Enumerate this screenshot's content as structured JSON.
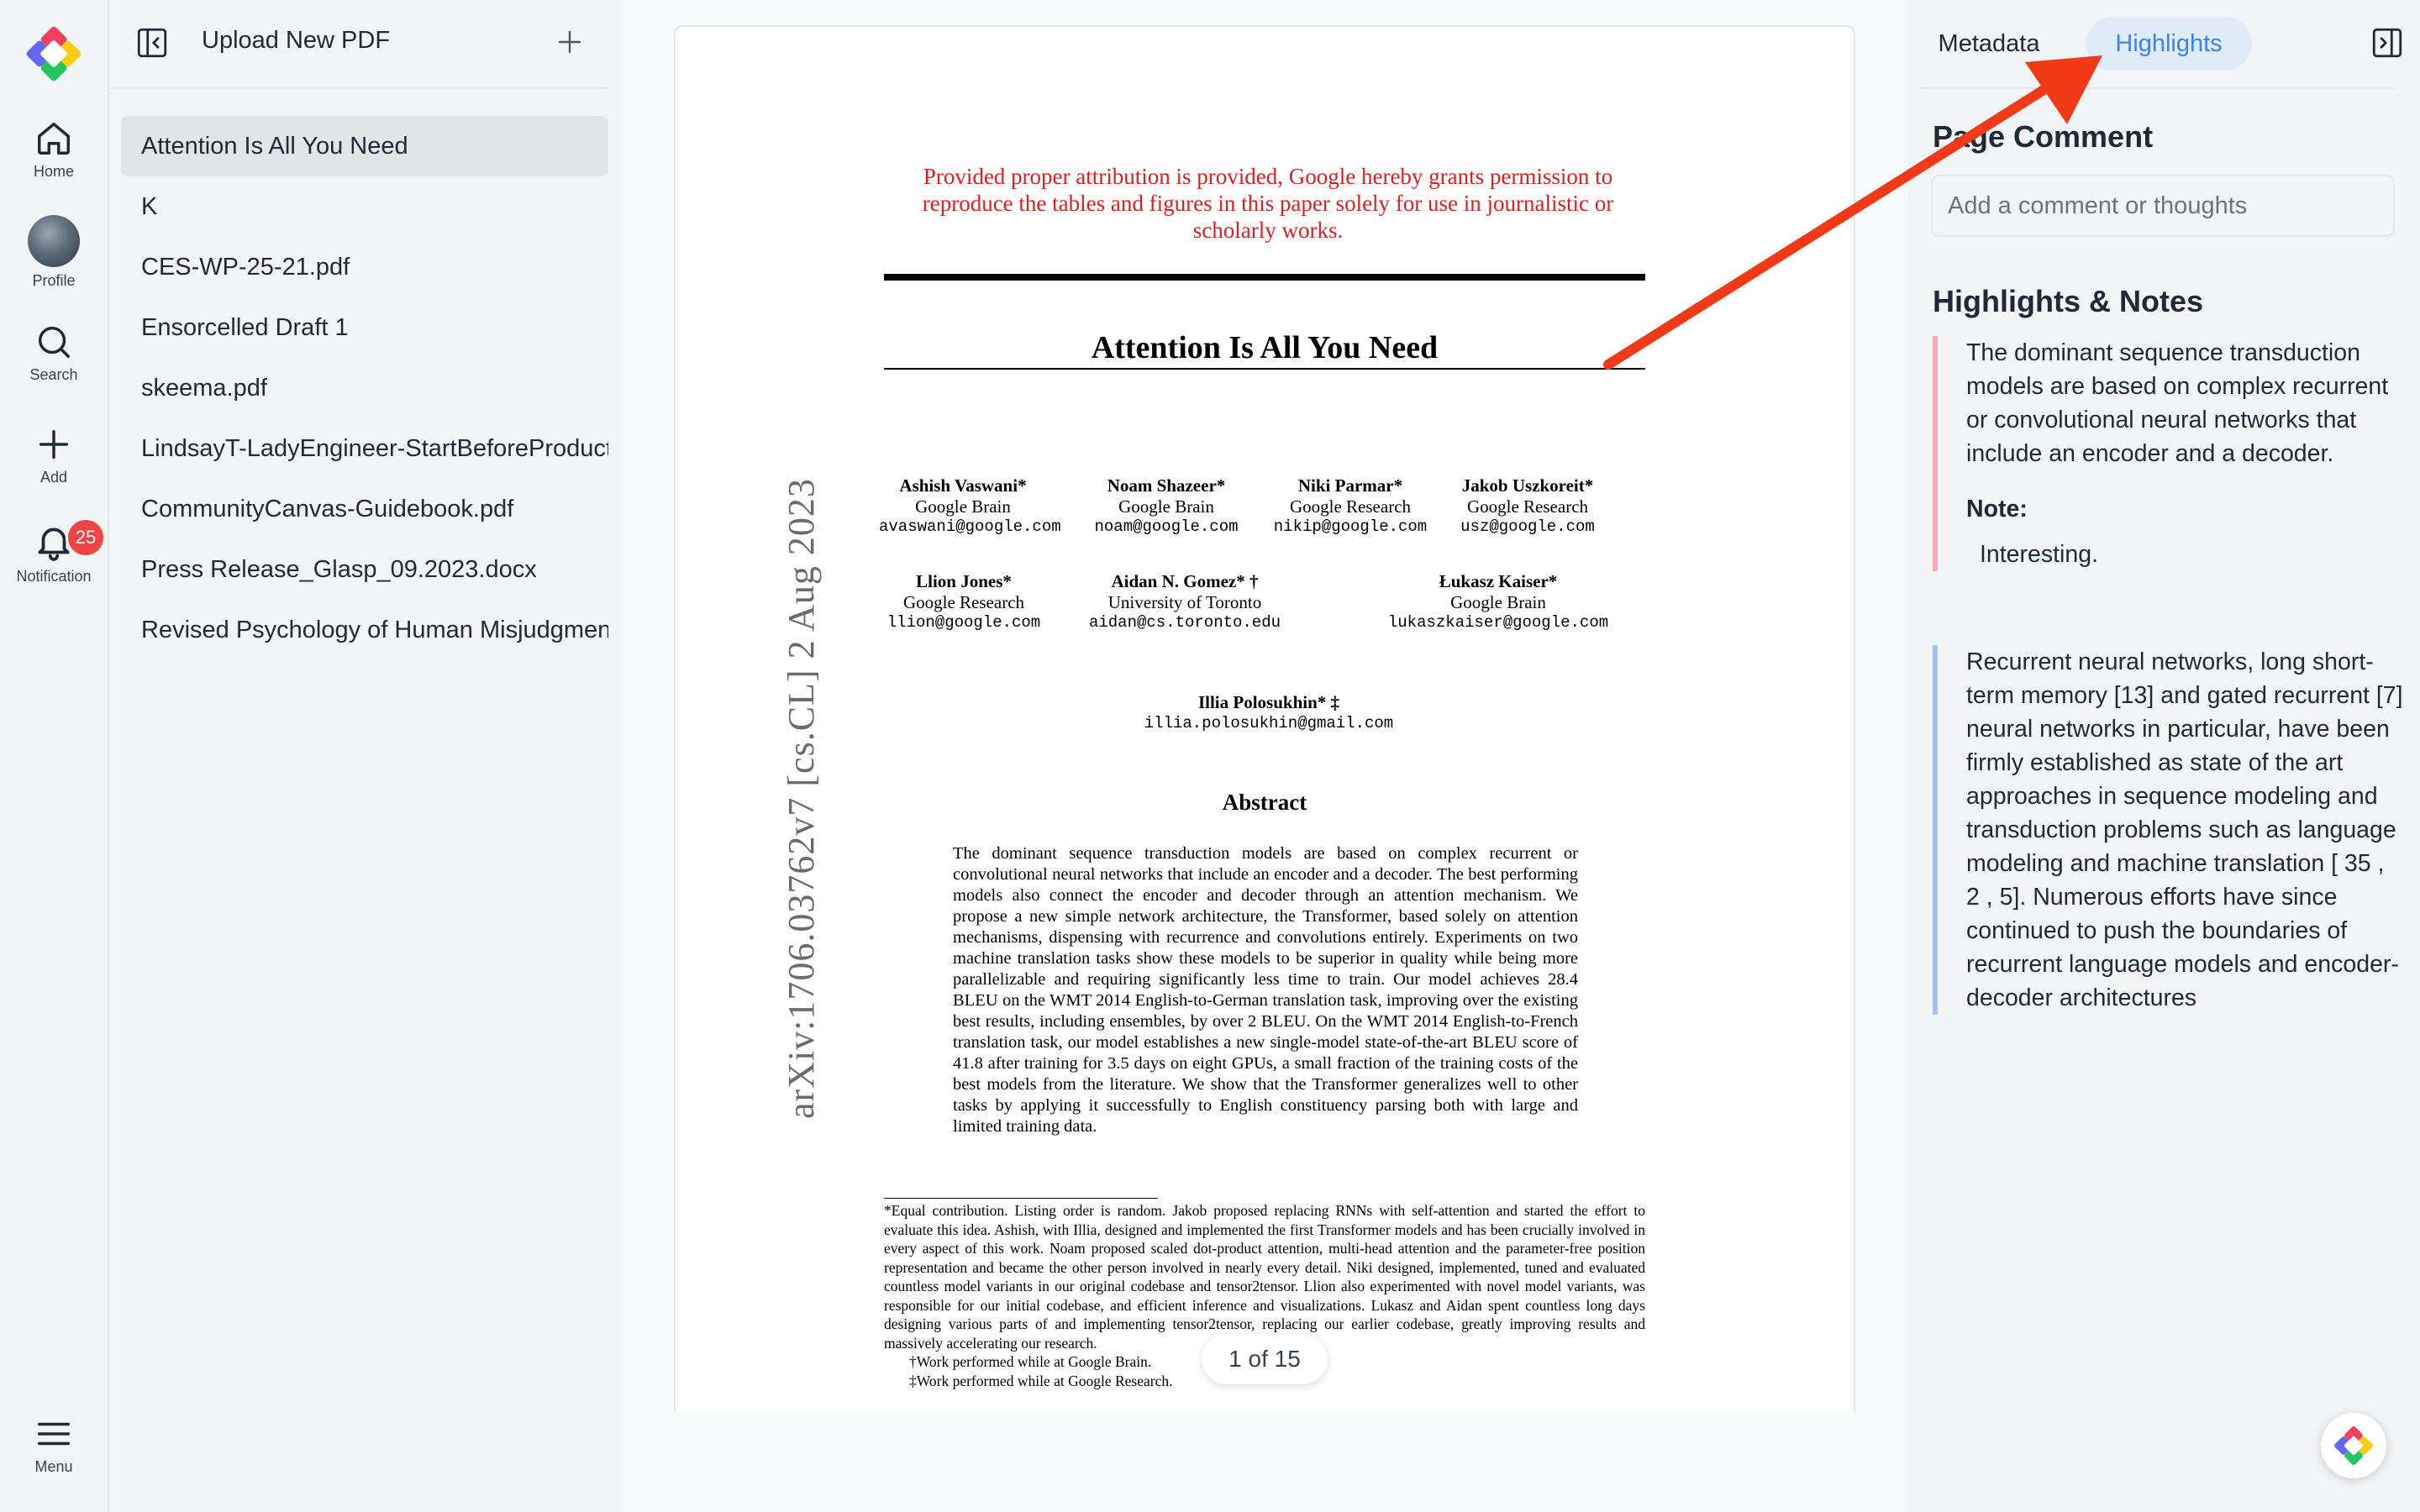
{
  "rail": {
    "home_label": "Home",
    "profile_label": "Profile",
    "search_label": "Search",
    "add_label": "Add",
    "notification_label": "Notification",
    "notification_count": "25",
    "menu_label": "Menu"
  },
  "file_panel": {
    "title": "Upload New PDF",
    "files": [
      "Attention Is All You Need",
      "K",
      "CES-WP-25-21.pdf",
      "Ensorcelled Draft 1",
      "skeema.pdf",
      "LindsayT-LadyEngineer-StartBeforeProduct",
      "CommunityCanvas-Guidebook.pdf",
      "Press Release_Glasp_09.2023.docx",
      "Revised Psychology of Human Misjudgment"
    ]
  },
  "document": {
    "attribution_note": "Provided proper attribution is provided, Google hereby grants permission to reproduce the tables and figures in this paper solely for use in journalistic or scholarly works.",
    "title": "Attention Is All You Need",
    "arxiv_id": "arXiv:1706.03762v7  [cs.CL]  2 Aug 2023",
    "authors": [
      {
        "name": "Ashish Vaswani*",
        "affiliation": "Google Brain",
        "email": "avaswani@google.com"
      },
      {
        "name": "Noam Shazeer*",
        "affiliation": "Google Brain",
        "email": "noam@google.com"
      },
      {
        "name": "Niki Parmar*",
        "affiliation": "Google Research",
        "email": "nikip@google.com"
      },
      {
        "name": "Jakob Uszkoreit*",
        "affiliation": "Google Research",
        "email": "usz@google.com"
      },
      {
        "name": "Llion Jones*",
        "affiliation": "Google Research",
        "email": "llion@google.com"
      },
      {
        "name": "Aidan N. Gomez* †",
        "affiliation": "University of Toronto",
        "email": "aidan@cs.toronto.edu"
      },
      {
        "name": "Łukasz Kaiser*",
        "affiliation": "Google Brain",
        "email": "lukaszkaiser@google.com"
      },
      {
        "name": "Illia Polosukhin* ‡",
        "affiliation": "",
        "email": "illia.polosukhin@gmail.com"
      }
    ],
    "abstract_heading": "Abstract",
    "abstract": "The dominant sequence transduction models are based on complex recurrent or convolutional neural networks that include an encoder and a decoder. The best performing models also connect the encoder and decoder through an attention mechanism. We propose a new simple network architecture, the Transformer, based solely on attention mechanisms, dispensing with recurrence and convolutions entirely. Experiments on two machine translation tasks show these models to be superior in quality while being more parallelizable and requiring significantly less time to train. Our model achieves 28.4 BLEU on the WMT 2014 English-to-German translation task, improving over the existing best results, including ensembles, by over 2 BLEU. On the WMT 2014 English-to-French translation task, our model establishes a new single-model state-of-the-art BLEU score of 41.8 after training for 3.5 days on eight GPUs, a small fraction of the training costs of the best models from the literature. We show that the Transformer generalizes well to other tasks by applying it successfully to English constituency parsing both with large and limited training data.",
    "footnote_equal": "*Equal contribution. Listing order is random. Jakob proposed replacing RNNs with self-attention and started the effort to evaluate this idea. Ashish, with Illia, designed and implemented the first Transformer models and has been crucially involved in every aspect of this work. Noam proposed scaled dot-product attention, multi-head attention and the parameter-free position representation and became the other person involved in nearly every detail. Niki designed, implemented, tuned and evaluated countless model variants in our original codebase and tensor2tensor. Llion also experimented with novel model variants, was responsible for our initial codebase, and efficient inference and visualizations. Lukasz and Aidan spent countless long days designing various parts of and implementing tensor2tensor, replacing our earlier codebase, greatly improving results and massively accelerating our research.",
    "footnote_brain": "†Work performed while at Google Brain.",
    "footnote_research": "‡Work performed while at Google Research.",
    "page_indicator": "1 of 15"
  },
  "right_panel": {
    "tab_metadata": "Metadata",
    "tab_highlights": "Highlights",
    "page_comment_heading": "Page Comment",
    "comment_placeholder": "Add a comment or thoughts",
    "highlights_heading": "Highlights & Notes",
    "highlights": [
      {
        "text": "The dominant sequence transduction models are based on complex recurrent or convolutional neural networks that include an encoder and a decoder.",
        "note_label": "Note:",
        "note": "Interesting.",
        "color": "#f9a8b8"
      },
      {
        "text": "Recurrent neural networks, long short-term memory [13] and gated recurrent [7] neural networks in particular, have been firmly established as state of the art approaches in sequence modeling and transduction problems such as language modeling and machine translation [ 35 , 2 , 5]. Numerous efforts have since continued to push the boundaries of recurrent language models and encoder-decoder architectures",
        "color": "#a5c0f3"
      }
    ]
  },
  "colors": {
    "accent": "#3b82f6",
    "annotation_arrow": "#f03a17",
    "badge": "#ef4444",
    "attribution_red": "#e11d1d"
  }
}
